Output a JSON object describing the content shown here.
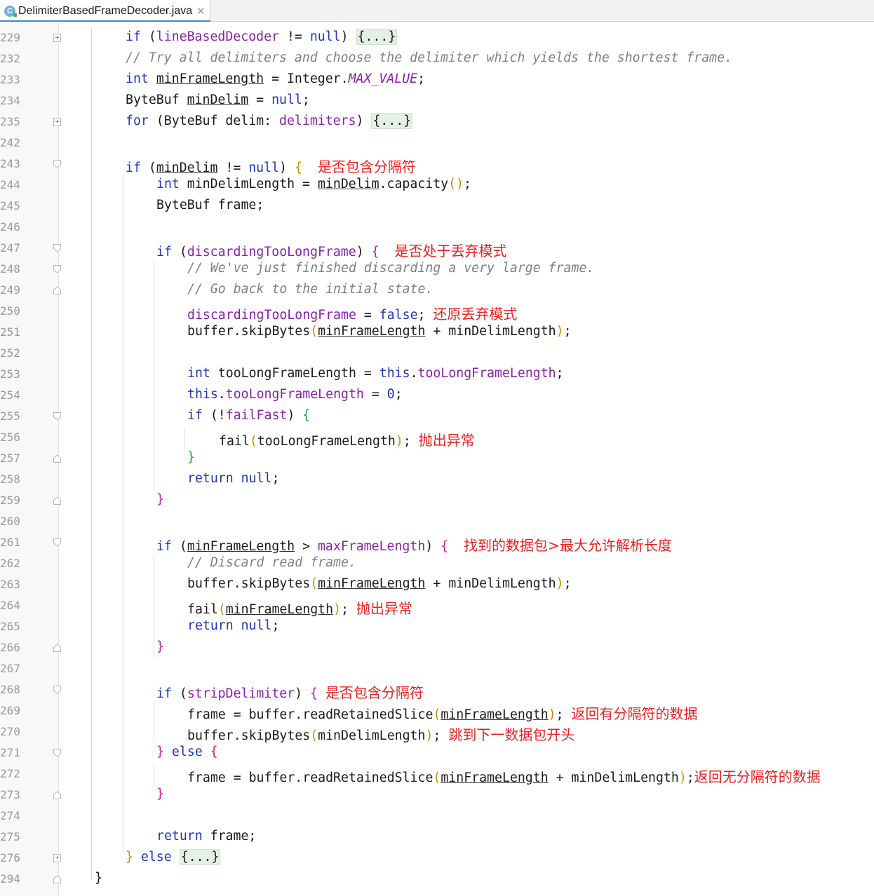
{
  "tab": {
    "icon_letter": "C",
    "file_name": "DelimiterBasedFrameDecoder.java",
    "close_glyph": "✕"
  },
  "lines": [
    {
      "n": "229",
      "fold": "plus"
    },
    {
      "n": "232",
      "fold": ""
    },
    {
      "n": "233",
      "fold": ""
    },
    {
      "n": "234",
      "fold": ""
    },
    {
      "n": "235",
      "fold": "plus"
    },
    {
      "n": "242",
      "fold": ""
    },
    {
      "n": "243",
      "fold": "down"
    },
    {
      "n": "244",
      "fold": ""
    },
    {
      "n": "245",
      "fold": ""
    },
    {
      "n": "246",
      "fold": ""
    },
    {
      "n": "247",
      "fold": "down"
    },
    {
      "n": "248",
      "fold": "down"
    },
    {
      "n": "249",
      "fold": "up"
    },
    {
      "n": "250",
      "fold": ""
    },
    {
      "n": "251",
      "fold": ""
    },
    {
      "n": "252",
      "fold": ""
    },
    {
      "n": "253",
      "fold": ""
    },
    {
      "n": "254",
      "fold": ""
    },
    {
      "n": "255",
      "fold": "down"
    },
    {
      "n": "256",
      "fold": ""
    },
    {
      "n": "257",
      "fold": "up"
    },
    {
      "n": "258",
      "fold": ""
    },
    {
      "n": "259",
      "fold": "up"
    },
    {
      "n": "260",
      "fold": ""
    },
    {
      "n": "261",
      "fold": "down"
    },
    {
      "n": "262",
      "fold": ""
    },
    {
      "n": "263",
      "fold": ""
    },
    {
      "n": "264",
      "fold": ""
    },
    {
      "n": "265",
      "fold": ""
    },
    {
      "n": "266",
      "fold": "up"
    },
    {
      "n": "267",
      "fold": ""
    },
    {
      "n": "268",
      "fold": "down"
    },
    {
      "n": "269",
      "fold": ""
    },
    {
      "n": "270",
      "fold": ""
    },
    {
      "n": "271",
      "fold": "down"
    },
    {
      "n": "272",
      "fold": ""
    },
    {
      "n": "273",
      "fold": "up"
    },
    {
      "n": "274",
      "fold": ""
    },
    {
      "n": "275",
      "fold": ""
    },
    {
      "n": "276",
      "fold": "plus"
    },
    {
      "n": "294",
      "fold": "up"
    }
  ],
  "code": {
    "l229": {
      "a": "if",
      "b": " (",
      "c": "lineBasedDecoder",
      "d": " != ",
      "e": "null",
      "f": ") ",
      "g": "{...}"
    },
    "l232": {
      "a": "// Try all delimiters and choose the delimiter which yields the shortest frame."
    },
    "l233": {
      "a": "int",
      "b": " ",
      "c": "minFrameLength",
      "d": " = Integer.",
      "e": "MAX_VALUE",
      "f": ";"
    },
    "l234": {
      "a": "ByteBuf ",
      "b": "minDelim",
      "c": " = ",
      "d": "null",
      "e": ";"
    },
    "l235": {
      "a": "for",
      "b": " (ByteBuf delim: ",
      "c": "delimiters",
      "d": ") ",
      "e": "{...}"
    },
    "l243": {
      "a": "if",
      "b": " (",
      "c": "minDelim",
      "d": " != ",
      "e": "null",
      "f": ") ",
      "g": "{",
      "note": "是否包含分隔符"
    },
    "l244": {
      "a": "int",
      "b": " minDelimLength = ",
      "c": "minDelim",
      "d": ".capacity",
      "e": "()",
      "f": ";"
    },
    "l245": {
      "a": "ByteBuf frame;"
    },
    "l247": {
      "a": "if",
      "b": " (",
      "c": "discardingTooLongFrame",
      "d": ") ",
      "e": "{",
      "note": "是否处于丢弃模式"
    },
    "l248": {
      "a": "// We've just finished discarding a very large frame."
    },
    "l249": {
      "a": "// Go back to the initial state."
    },
    "l250": {
      "a": "discardingTooLongFrame",
      "b": " = ",
      "c": "false",
      "d": ";",
      "note": "还原丢弃模式"
    },
    "l251": {
      "a": "buffer.skipBytes",
      "b": "(",
      "c": "minFrameLength",
      "d": " + minDelimLength",
      "e": ")",
      "f": ";"
    },
    "l253": {
      "a": "int",
      "b": " tooLongFrameLength = ",
      "c": "this",
      "d": ".",
      "e": "tooLongFrameLength",
      "f": ";"
    },
    "l254": {
      "a": "this",
      "b": ".",
      "c": "tooLongFrameLength",
      "d": " = ",
      "e": "0",
      "f": ";"
    },
    "l255": {
      "a": "if",
      "b": " (!",
      "c": "failFast",
      "d": ") ",
      "e": "{"
    },
    "l256": {
      "a": "fail",
      "b": "(",
      "c": "tooLongFrameLength",
      "d": ")",
      "e": ";",
      "note": "抛出异常"
    },
    "l257": {
      "a": "}"
    },
    "l258": {
      "a": "return",
      "b": " ",
      "c": "null",
      "d": ";"
    },
    "l259": {
      "a": "}"
    },
    "l261": {
      "a": "if",
      "b": " (",
      "c": "minFrameLength",
      "d": " > ",
      "e": "maxFrameLength",
      "f": ") ",
      "g": "{",
      "note": "找到的数据包>最大允许解析长度"
    },
    "l262": {
      "a": "// Discard read frame."
    },
    "l263": {
      "a": "buffer.skipBytes",
      "b": "(",
      "c": "minFrameLength",
      "d": " + minDelimLength",
      "e": ")",
      "f": ";"
    },
    "l264": {
      "a": "fail",
      "b": "(",
      "c": "minFrameLength",
      "d": ")",
      "e": ";",
      "note": "抛出异常"
    },
    "l265": {
      "a": "return",
      "b": " ",
      "c": "null",
      "d": ";"
    },
    "l266": {
      "a": "}"
    },
    "l268": {
      "a": "if",
      "b": " (",
      "c": "stripDelimiter",
      "d": ") ",
      "e": "{",
      "note": "是否包含分隔符"
    },
    "l269": {
      "a": "frame = buffer.readRetainedSlice",
      "b": "(",
      "c": "minFrameLength",
      "d": ")",
      "e": ";",
      "note": "返回有分隔符的数据"
    },
    "l270": {
      "a": "buffer.skipBytes",
      "b": "(",
      "c": "minDelimLength",
      "d": ")",
      "e": ";",
      "note": "跳到下一数据包开头"
    },
    "l271": {
      "a": "}",
      "b": " ",
      "c": "else",
      "d": " ",
      "e": "{"
    },
    "l272": {
      "a": "frame = buffer.readRetainedSlice",
      "b": "(",
      "c": "minFrameLength",
      "d": " + minDelimLength",
      "e": ")",
      "f": ";",
      "note": "返回无分隔符的数据"
    },
    "l273": {
      "a": "}"
    },
    "l275": {
      "a": "return",
      "b": " frame;"
    },
    "l276": {
      "a": "}",
      "b": " ",
      "c": "else",
      "d": " ",
      "e": "{...}"
    },
    "l294": {
      "a": "}"
    }
  },
  "colors": {
    "keyword": "#1f36b0",
    "field": "#8a1fa8",
    "comment": "#7f7f7f",
    "annotation": "#e8201e",
    "fold_bg": "#e3f0e3"
  }
}
